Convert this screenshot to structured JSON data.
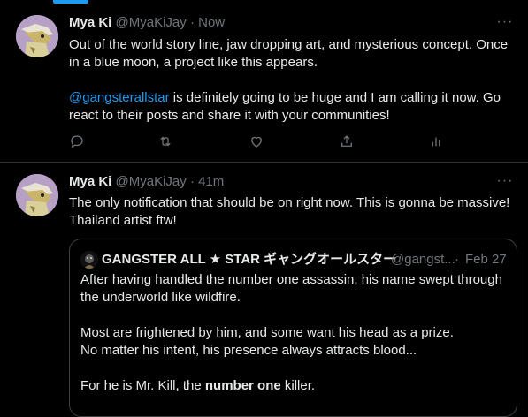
{
  "colors": {
    "background": "#000000",
    "accent": "#1d9bf0",
    "muted": "#71767b",
    "text": "#e7e9ea",
    "border": "#2f3336"
  },
  "tweet1": {
    "name": "Mya Ki",
    "handle": "@MyaKiJay",
    "dot": "·",
    "time": "Now",
    "more": "···",
    "para1": "Out of the world story line, jaw dropping art, and mysterious concept. Once in a blue moon, a project like this appears.",
    "mention": "@gangsterallstar",
    "para2_rest": " is definitely going to be huge and I am calling it now. Go react to their posts and share it with your communities!",
    "actions": [
      "reply-icon",
      "retweet-icon",
      "like-icon",
      "share-icon",
      "analytics-icon"
    ]
  },
  "tweet2": {
    "name": "Mya Ki",
    "handle": "@MyaKiJay",
    "dot": "·",
    "time": "41m",
    "more": "···",
    "text": "The only notification that should be on right now. This is gonna be massive! Thailand artist ftw!",
    "quote": {
      "name": "GANGSTER ALL ★ STAR ギャングオールスター",
      "handle": "@gangst...",
      "dot": "·",
      "time": "Feb 27",
      "para1": "After having handled the number one assassin, his name swept through the underworld like wildfire.",
      "para2_line1": "Most are frightened by him, and some want his head as a prize.",
      "para2_line2": "No matter his intent, his presence always attracts blood...",
      "para3_start": "For he is Mr. Kill, the ",
      "para3_bold": "number one",
      "para3_end": " killer."
    }
  }
}
